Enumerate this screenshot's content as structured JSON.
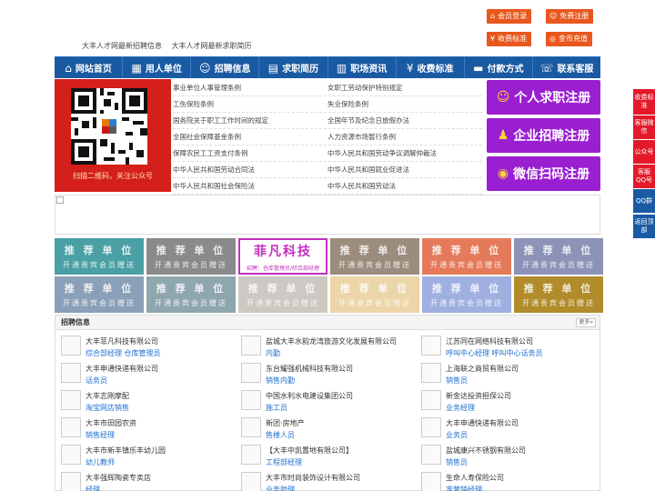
{
  "header": {
    "links": [
      "大丰人才网最新招聘信息",
      "大丰人才网最新求职简历"
    ],
    "buttons": {
      "login": "会员登录",
      "register": "免费注册",
      "fee": "收费标准",
      "recharge": "金币充值"
    }
  },
  "nav": [
    {
      "label": "网站首页",
      "icon": "home-icon",
      "glyph": "⌂"
    },
    {
      "label": "用人单位",
      "icon": "building-icon",
      "glyph": "▦"
    },
    {
      "label": "招聘信息",
      "icon": "people-icon",
      "glyph": "☺"
    },
    {
      "label": "求职简历",
      "icon": "resume-icon",
      "glyph": "▤"
    },
    {
      "label": "职场资讯",
      "icon": "news-icon",
      "glyph": "▥"
    },
    {
      "label": "收费标准",
      "icon": "yen-icon",
      "glyph": "¥"
    },
    {
      "label": "付款方式",
      "icon": "card-icon",
      "glyph": "▬"
    },
    {
      "label": "联系客服",
      "icon": "phone-icon",
      "glyph": "☏"
    }
  ],
  "qr": {
    "caption": "扫描二维码，关注公众号"
  },
  "law_links": [
    [
      "事业单位人事管理条例",
      "女职工劳动保护特别规定"
    ],
    [
      "工伤保险条例",
      "失业保险条例"
    ],
    [
      "国务院关于职工工作时间的规定",
      "全国年节及纪念日放假办法"
    ],
    [
      "全国社会保障基金条例",
      "人力资源市场暂行条例"
    ],
    [
      "保障农民工工资支付条例",
      "中华人民共和国劳动争议调解仲裁法"
    ],
    [
      "中华人民共和国劳动合同法",
      "中华人民共和国就业促进法"
    ],
    [
      "中华人民共和国社会保险法",
      "中华人民共和国劳动法"
    ]
  ],
  "register": {
    "personal": "个人求职注册",
    "company": "企业招聘注册",
    "wechat": "微信扫码注册"
  },
  "side": [
    {
      "label": "收费标准",
      "color": "#e3192a"
    },
    {
      "label": "客服微信",
      "color": "#e3192a"
    },
    {
      "label": "公众号",
      "color": "#e3192a"
    },
    {
      "label": "客服QQ号",
      "color": "#e3192a"
    },
    {
      "label": "QQ群",
      "color": "#1a5aa3"
    },
    {
      "label": "返回顶部",
      "color": "#1a5aa3"
    }
  ],
  "recommend": {
    "title": "推 荐 单 位",
    "sub": "开通贵宾会员赠送",
    "feature": {
      "name": "菲凡科技",
      "desc": "招聘：仓库管理员/综合部经理"
    },
    "colors": [
      [
        "#4aa0a4",
        "#8a8a8a",
        "feature",
        "#9c8c7e",
        "#e57a5a",
        "#8d92b8"
      ],
      [
        "#8aa0b8",
        "#8ea6ad",
        "#ccc9c2",
        "#ecd5a8",
        "#9fb0e0",
        "#b28b2a"
      ]
    ]
  },
  "recruit": {
    "title": "招聘信息",
    "more": "更多»",
    "jobs": [
      [
        {
          "company": "大丰菲凡科技有限公司",
          "positions": "综合部经理 仓库管理员"
        },
        {
          "company": "大丰申通快递有限公司",
          "positions": "话务员"
        },
        {
          "company": "大丰志刚摩配",
          "positions": "淘宝网店销售"
        },
        {
          "company": "大丰市田园农资",
          "positions": "销售经理"
        },
        {
          "company": "大丰市新丰镇乐丰幼儿园",
          "positions": "幼儿教师"
        },
        {
          "company": "大丰强辉陶瓷专卖店",
          "positions": "经理"
        }
      ],
      [
        {
          "company": "盐城大丰水韵龙湾旅游文化发展有限公司",
          "positions": "内勤"
        },
        {
          "company": "东台耀强机械科技有限公司",
          "positions": "销售内勤"
        },
        {
          "company": "中国水利水电建设集团公司",
          "positions": "施工员"
        },
        {
          "company": "新团·房地产",
          "positions": "售楼人员"
        },
        {
          "company": "【大丰中凯置地有限公司】",
          "positions": "工程部经理"
        },
        {
          "company": "大丰市时尚装饰设计有限公司",
          "positions": "业务助理"
        }
      ],
      [
        {
          "company": "江苏同在网络科技有限公司",
          "positions": "呼叫中心经理 呼叫中心话务员"
        },
        {
          "company": "上海联之商贸有限公司",
          "positions": "销售员"
        },
        {
          "company": "新金达投资担保公司",
          "positions": "业务经理"
        },
        {
          "company": "大丰申通快递有限公司",
          "positions": "业务员"
        },
        {
          "company": "盐城康兴不锈钢有限公司",
          "positions": "销售员"
        },
        {
          "company": "生命人寿保险公司",
          "positions": "准营销经理"
        }
      ]
    ]
  }
}
